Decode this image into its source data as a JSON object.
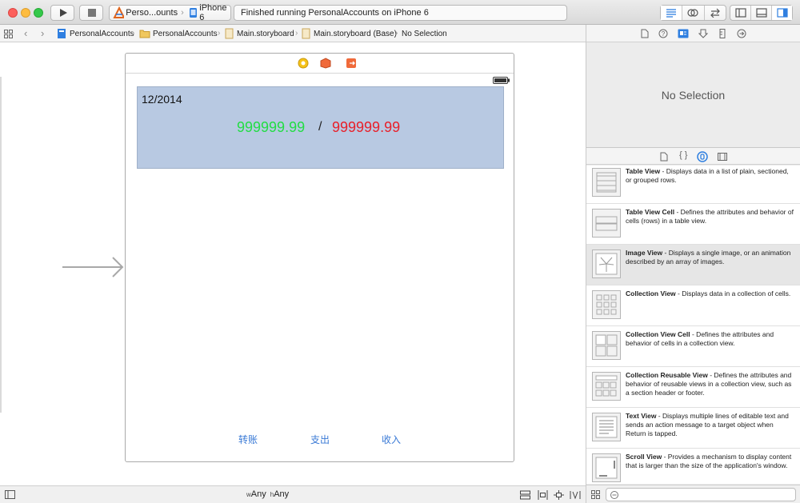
{
  "toolbar": {
    "scheme_target": "Perso...ounts",
    "device": "iPhone 6",
    "status": "Finished running PersonalAccounts on iPhone 6"
  },
  "jumpbar": {
    "crumbs": [
      "PersonalAccounts",
      "PersonalAccounts",
      "Main.storyboard",
      "Main.storyboard (Base)",
      "No Selection"
    ]
  },
  "scene": {
    "date": "12/2014",
    "income_value": "999999.99",
    "separator": "/",
    "expense_value": "999999.99",
    "buttons": {
      "transfer": "转账",
      "expense": "支出",
      "income": "收入"
    }
  },
  "bottombar": {
    "size_class_w_prefix": "w",
    "size_class_w": "Any",
    "size_class_h_prefix": "h",
    "size_class_h": "Any"
  },
  "inspector": {
    "no_selection": "No Selection"
  },
  "library": {
    "items": [
      {
        "name": "Table View",
        "desc": " - Displays data in a list of plain, sectioned, or grouped rows."
      },
      {
        "name": "Table View Cell",
        "desc": " - Defines the attributes and behavior of cells (rows) in a table view."
      },
      {
        "name": "Image View",
        "desc": " - Displays a single image, or an animation described by an array of images."
      },
      {
        "name": "Collection View",
        "desc": " - Displays data in a collection of cells."
      },
      {
        "name": "Collection View Cell",
        "desc": " - Defines the attributes and behavior of cells in a collection view."
      },
      {
        "name": "Collection Reusable View",
        "desc": " - Defines the attributes and behavior of reusable views in a collection view, such as a section header or footer."
      },
      {
        "name": "Text View",
        "desc": " - Displays multiple lines of editable text and sends an action message to a target object when Return is tapped."
      },
      {
        "name": "Scroll View",
        "desc": " - Provides a mechanism to display content that is larger than the size of the application's window."
      }
    ]
  },
  "colors": {
    "header_bg": "#b8c9e2",
    "income_green": "#22dd44",
    "expense_red": "#e8202a",
    "button_blue": "#3a7ad6",
    "accent_blue": "#2f7fe0"
  }
}
